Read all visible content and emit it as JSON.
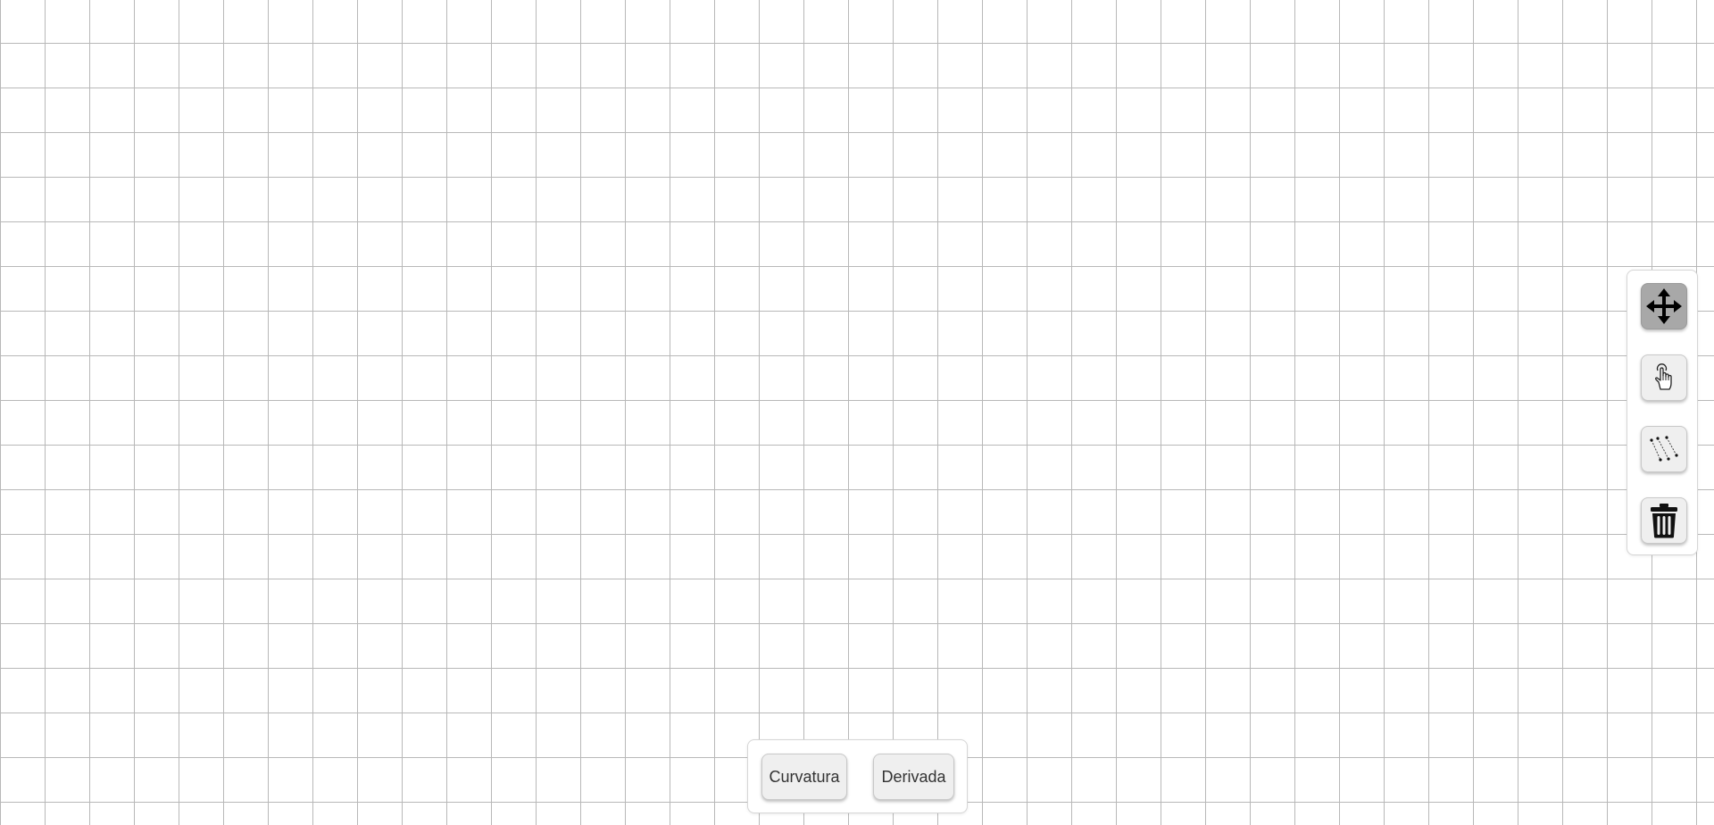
{
  "canvas": {
    "grid_color": "#b8b8b8",
    "background_color": "#ffffff"
  },
  "toolbar": {
    "tools": [
      {
        "id": "move",
        "icon": "move-arrows-icon",
        "active": true
      },
      {
        "id": "select",
        "icon": "hand-pointer-icon",
        "active": false
      },
      {
        "id": "draw-lines",
        "icon": "polyline-points-icon",
        "active": false
      },
      {
        "id": "delete",
        "icon": "trash-icon",
        "active": false
      }
    ],
    "active_color": "#a8a8a8",
    "button_color": "#efefef"
  },
  "actions": {
    "curvatura_label": "Curvatura",
    "derivada_label": "Derivada"
  }
}
